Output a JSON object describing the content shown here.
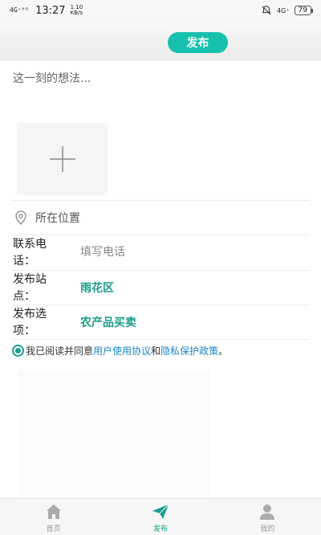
{
  "status_bar": {
    "network": "4G⁺ᴴᴰ",
    "time": "13:27",
    "speed_value": "1.10",
    "speed_unit": "KB/s",
    "right_network": "4G⁺",
    "battery": "79"
  },
  "header": {
    "publish_label": "发布"
  },
  "post": {
    "thought_placeholder": "这一刻的想法...",
    "location_label": "所在位置"
  },
  "form": {
    "phone_label": "联系电话：",
    "phone_placeholder": "填写电话",
    "station_label": "发布站点：",
    "station_value": "雨花区",
    "option_label": "发布选项：",
    "option_value": "农产品买卖"
  },
  "agreement": {
    "prefix": "我已阅读并同意",
    "user_agreement": "用户使用协议",
    "and": "和",
    "privacy_policy": "隐私保护政策",
    "suffix": "。"
  },
  "bottom_nav": {
    "home": "首页",
    "publish": "发布",
    "mine": "我的"
  },
  "colors": {
    "accent": "#17c1ad",
    "green_text": "#1a9d8a",
    "link": "#1a87c9"
  }
}
